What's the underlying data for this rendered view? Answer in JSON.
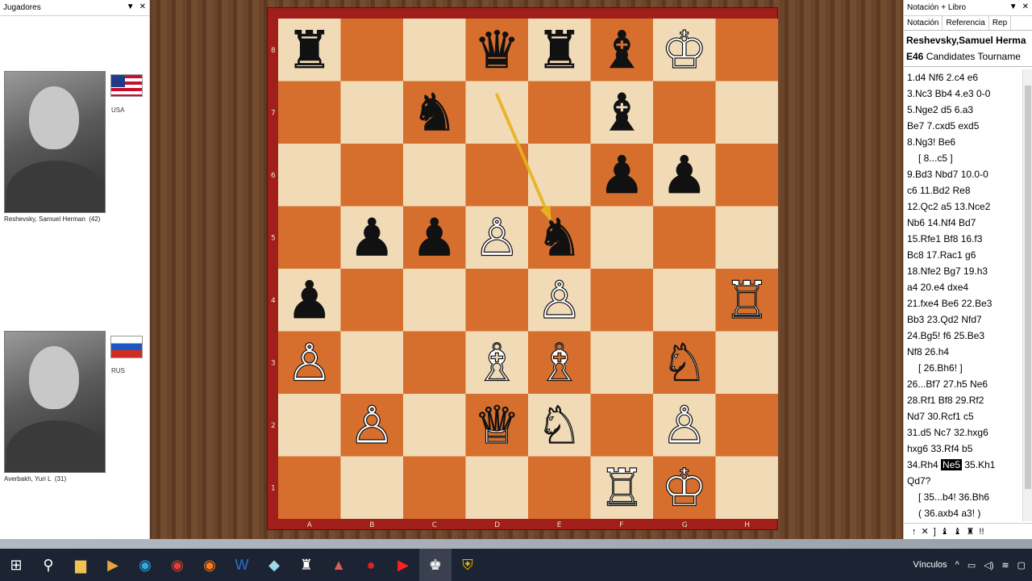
{
  "players_panel": {
    "title": "Jugadores",
    "white": {
      "name": "Reshevsky, Samuel Herman",
      "age": "(42)",
      "country": "USA"
    },
    "black": {
      "name": "Averbakh, Yuri L",
      "age": "(31)",
      "country": "RUS"
    }
  },
  "board": {
    "files": [
      "A",
      "B",
      "C",
      "D",
      "E",
      "F",
      "G",
      "H"
    ],
    "ranks": [
      "8",
      "7",
      "6",
      "5",
      "4",
      "3",
      "2",
      "1"
    ],
    "light_color": "#f1dbb7",
    "dark_color": "#d66f2d",
    "arrow_color": "#e8b21e",
    "arrow": {
      "from": "d7",
      "to": "e5"
    },
    "pieces": [
      {
        "sq": "a8",
        "glyph": "♜",
        "side": "black"
      },
      {
        "sq": "d8",
        "glyph": "♛",
        "side": "black"
      },
      {
        "sq": "e8",
        "glyph": "♜",
        "side": "black"
      },
      {
        "sq": "f8",
        "glyph": "♝",
        "side": "black"
      },
      {
        "sq": "g8",
        "glyph": "♔",
        "side": "white"
      },
      {
        "sq": "c7",
        "glyph": "♞",
        "side": "black"
      },
      {
        "sq": "f7",
        "glyph": "♝",
        "side": "black"
      },
      {
        "sq": "f6",
        "glyph": "♟",
        "side": "black"
      },
      {
        "sq": "g6",
        "glyph": "♟",
        "side": "black"
      },
      {
        "sq": "b5",
        "glyph": "♟",
        "side": "black"
      },
      {
        "sq": "c5",
        "glyph": "♟",
        "side": "black"
      },
      {
        "sq": "d5",
        "glyph": "♙",
        "side": "white"
      },
      {
        "sq": "e5",
        "glyph": "♞",
        "side": "black"
      },
      {
        "sq": "a4",
        "glyph": "♟",
        "side": "black"
      },
      {
        "sq": "e4",
        "glyph": "♙",
        "side": "white"
      },
      {
        "sq": "h4",
        "glyph": "♖",
        "side": "white"
      },
      {
        "sq": "a3",
        "glyph": "♙",
        "side": "white"
      },
      {
        "sq": "d3",
        "glyph": "♗",
        "side": "white"
      },
      {
        "sq": "e3",
        "glyph": "♗",
        "side": "white"
      },
      {
        "sq": "g3",
        "glyph": "♘",
        "side": "white"
      },
      {
        "sq": "b2",
        "glyph": "♙",
        "side": "white"
      },
      {
        "sq": "d2",
        "glyph": "♕",
        "side": "white"
      },
      {
        "sq": "e2",
        "glyph": "♘",
        "side": "white"
      },
      {
        "sq": "g2",
        "glyph": "♙",
        "side": "white"
      },
      {
        "sq": "f1",
        "glyph": "♖",
        "side": "white"
      },
      {
        "sq": "g1",
        "glyph": "♔",
        "side": "white"
      }
    ]
  },
  "notation_panel": {
    "title": "Notación + Libro",
    "tabs": [
      "Notación",
      "Referencia",
      "Rep"
    ],
    "game_players": "Reshevsky,Samuel Herma",
    "eco": "E46",
    "event": "Candidates Tourname",
    "moves": [
      {
        "t": "1.d4  Nf6  2.c4  e6"
      },
      {
        "t": "3.Nc3  Bb4  4.e3  0-0"
      },
      {
        "t": "5.Nge2  d5  6.a3"
      },
      {
        "t": "Be7  7.cxd5  exd5"
      },
      {
        "t": "8.Ng3!  Be6"
      },
      {
        "t": "[ 8...c5 ]",
        "var": true
      },
      {
        "t": "9.Bd3  Nbd7  10.0-0"
      },
      {
        "t": "c6  11.Bd2  Re8"
      },
      {
        "t": "12.Qc2  a5  13.Nce2"
      },
      {
        "t": "Nb6  14.Nf4  Bd7"
      },
      {
        "t": "15.Rfe1  Bf8  16.f3"
      },
      {
        "t": "Bc8  17.Rac1  g6"
      },
      {
        "t": "18.Nfe2  Bg7  19.h3"
      },
      {
        "t": "a4  20.e4  dxe4"
      },
      {
        "t": "21.fxe4  Be6  22.Be3"
      },
      {
        "t": "Bb3  23.Qd2  Nfd7"
      },
      {
        "t": "24.Bg5!  f6  25.Be3"
      },
      {
        "t": "Nf8  26.h4"
      },
      {
        "t": "[ 26.Bh6! ]",
        "var": true
      },
      {
        "t": "26...Bf7  27.h5  Ne6"
      },
      {
        "t": "28.Rf1  Bf8  29.Rf2"
      },
      {
        "t": "Nd7  30.Rcf1  c5"
      },
      {
        "t": "31.d5  Nc7  32.hxg6"
      },
      {
        "t": "hxg6  33.Rf4  b5"
      },
      {
        "t": "34.Rh4",
        "current": "Ne5",
        "after": "35.Kh1"
      },
      {
        "t": "Qd7?"
      },
      {
        "t": "[ 35...b4!  36.Bh6",
        "var": true
      },
      {
        "t": "( 36.axb4  a3! )",
        "var": true
      }
    ],
    "toolbar_glyphs": [
      "↑",
      "✕",
      "]",
      "♝",
      "♝",
      "♜",
      "!!"
    ]
  },
  "taskbar": {
    "tray_text": "Vínculos",
    "icons": [
      "windows-icon",
      "search-icon",
      "file-explorer-icon",
      "media-icon",
      "edge-icon",
      "chrome-icon",
      "firefox-icon",
      "word-icon",
      "notes-icon",
      "chess-icon",
      "app-icon",
      "record-icon",
      "youtube-icon",
      "chessbase-icon",
      "shield-icon"
    ]
  }
}
